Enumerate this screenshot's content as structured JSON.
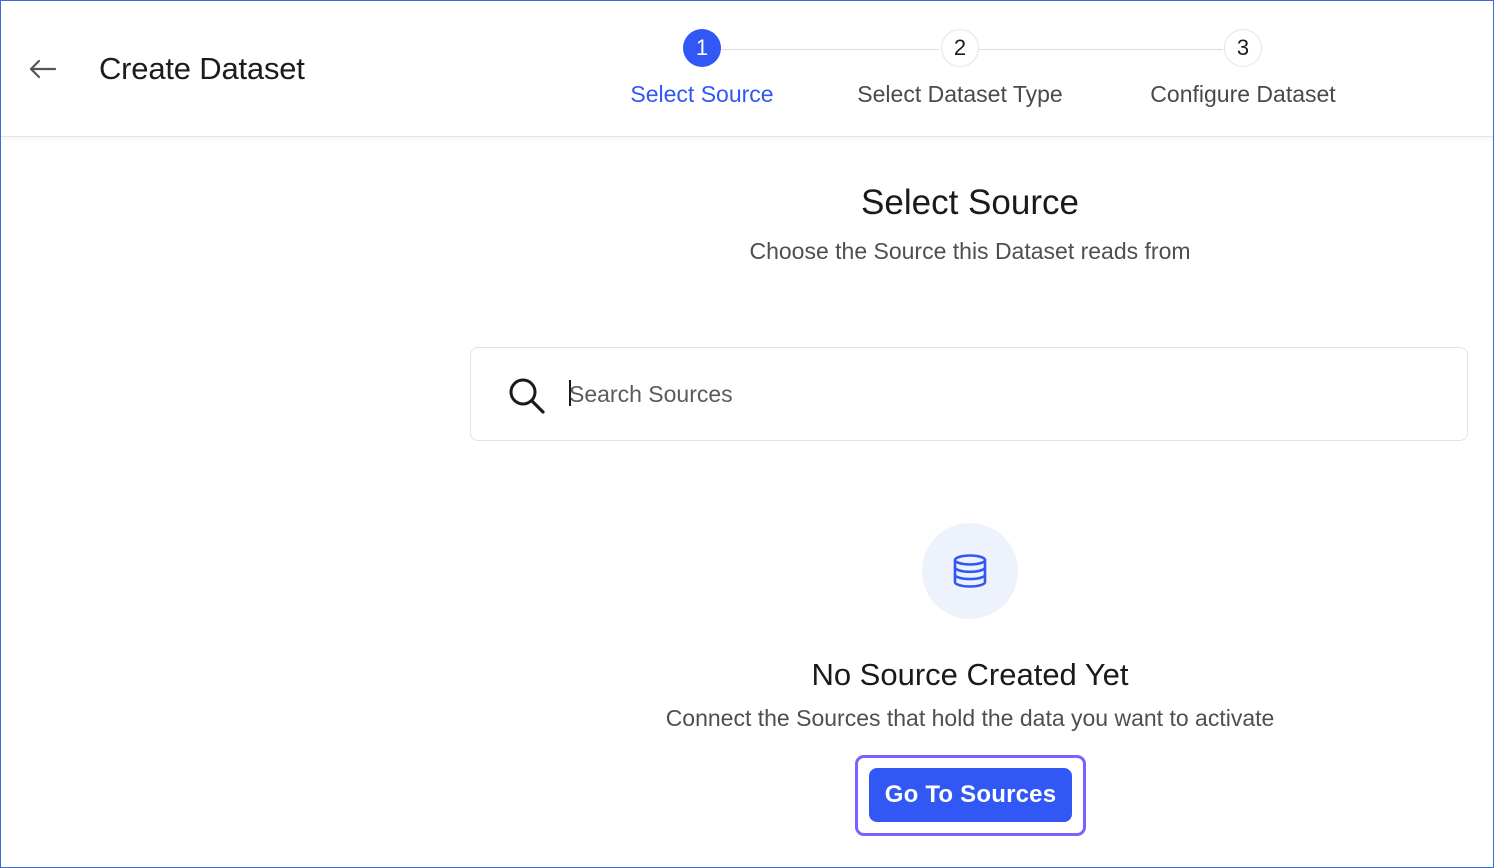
{
  "header": {
    "title": "Create Dataset",
    "back_icon": "arrow-left-icon"
  },
  "stepper": {
    "steps": [
      {
        "number": "1",
        "label": "Select Source",
        "state": "active"
      },
      {
        "number": "2",
        "label": "Select Dataset Type",
        "state": "inactive"
      },
      {
        "number": "3",
        "label": "Configure Dataset",
        "state": "inactive"
      }
    ]
  },
  "main": {
    "title": "Select Source",
    "subtitle": "Choose the Source this Dataset reads from",
    "search": {
      "placeholder": "Search Sources",
      "value": "",
      "icon": "search-icon"
    },
    "empty_state": {
      "icon": "database-icon",
      "title": "No Source Created Yet",
      "description": "Connect the Sources that hold the data you want to activate",
      "button_label": "Go To Sources"
    }
  },
  "colors": {
    "accent": "#3157f5",
    "focus_ring": "#7b61ff",
    "icon_bg": "#eef2fd",
    "frame_border": "#3b6bd9"
  }
}
